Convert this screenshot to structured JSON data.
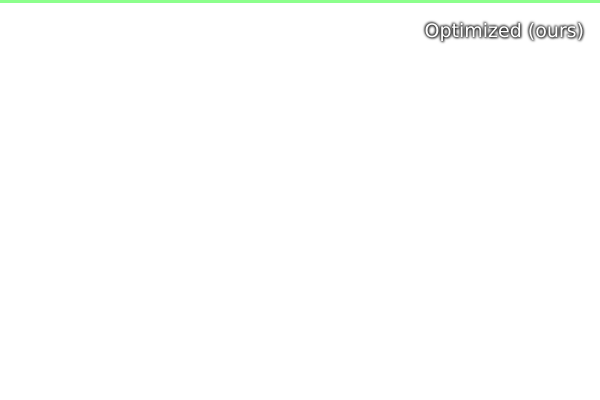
{
  "window": {
    "accent_color": "#8cff8c",
    "background_color": "#ffffff"
  },
  "overlay": {
    "label": "Optimized (ours)"
  }
}
